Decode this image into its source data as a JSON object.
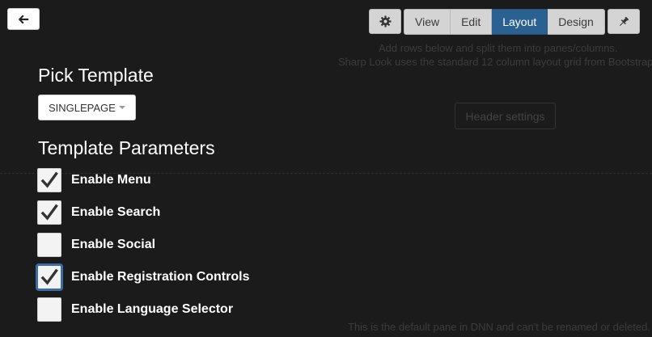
{
  "background": {
    "line1": "Add rows below and split them into panes/columns.",
    "line2": "Sharp Look uses the standard 12 column layout grid from Bootstrap.",
    "header_settings": "Header settings",
    "footer_note": "This is the default pane in DNN and can't be renamed or deleted."
  },
  "toolbar": {
    "settings_icon": "gear-icon",
    "tabs": [
      {
        "label": "View",
        "active": false
      },
      {
        "label": "Edit",
        "active": false
      },
      {
        "label": "Layout",
        "active": true
      },
      {
        "label": "Design",
        "active": false
      }
    ],
    "pin_icon": "pin-icon"
  },
  "back_button": {
    "icon": "arrow-left-icon"
  },
  "template": {
    "heading": "Pick Template",
    "selected": "SINGLEPAGE"
  },
  "parameters": {
    "heading": "Template Parameters",
    "items": [
      {
        "label": "Enable Menu",
        "checked": true
      },
      {
        "label": "Enable Search",
        "checked": true
      },
      {
        "label": "Enable Social",
        "checked": false
      },
      {
        "label": "Enable Registration Controls",
        "checked": true,
        "focused": true
      },
      {
        "label": "Enable Language Selector",
        "checked": false
      }
    ]
  },
  "colors": {
    "background": "#1b1b1b",
    "active_tab": "#2b6190",
    "focus_ring": "#3d6da6"
  }
}
